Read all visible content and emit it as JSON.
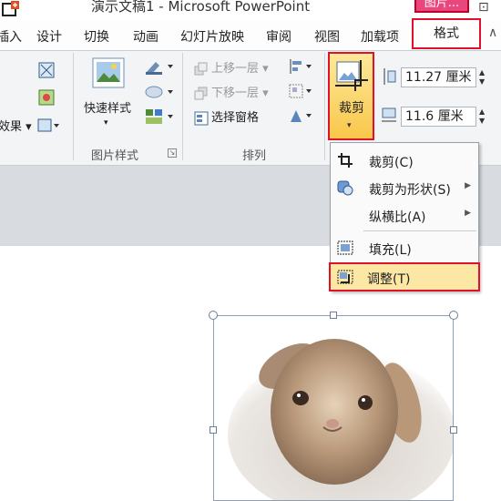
{
  "window": {
    "title": "演示文稿1 - Microsoft PowerPoint",
    "context_tab_group": "图片...",
    "minimize_glyph": "⊡"
  },
  "tabs": [
    {
      "label": "插入"
    },
    {
      "label": "设计"
    },
    {
      "label": "切换"
    },
    {
      "label": "动画"
    },
    {
      "label": "幻灯片放映"
    },
    {
      "label": "审阅"
    },
    {
      "label": "视图"
    },
    {
      "label": "加载项"
    },
    {
      "label": "格式",
      "active": true
    }
  ],
  "collapse_glyph": "∧",
  "ribbon": {
    "left_partial": {
      "effects_label": "效果"
    },
    "picture_styles": {
      "quick_styles_label": "快速样式",
      "group_label": "图片样式"
    },
    "arrange": {
      "bring_forward": "上移一层",
      "send_backward": "下移一层",
      "selection_pane": "选择窗格",
      "group_label": "排列"
    },
    "crop": {
      "label": "裁剪",
      "arrow": "▾"
    },
    "size": {
      "height": "11.27 厘米",
      "width": "11.6 厘米"
    }
  },
  "crop_menu": {
    "items": [
      {
        "label": "裁剪(C)",
        "submenu": false
      },
      {
        "label": "裁剪为形状(S)",
        "submenu": true
      },
      {
        "label": "纵横比(A)",
        "submenu": true
      },
      {
        "label": "填充(L)",
        "submenu": false
      },
      {
        "label": "调整(T)",
        "submenu": false,
        "highlighted": true
      }
    ],
    "submenu_arrow": "▶"
  },
  "colors": {
    "highlight_red": "#e0112b",
    "context_tab_pink": "#e8467c",
    "crop_button_gold": "#f9c74b"
  }
}
